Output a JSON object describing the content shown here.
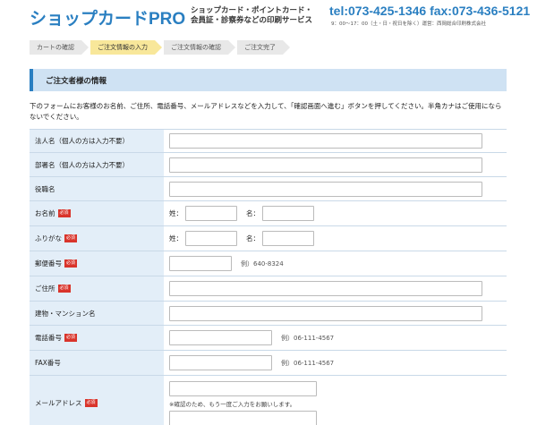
{
  "header": {
    "logo": "ショップカードPRO",
    "tagline_line1": "ショップカード・ポイントカード・",
    "tagline_line2": "会員証・診察券などの印刷サービス",
    "tel": "tel:073-425-1346 fax:073-436-5121",
    "hours": "9：00～17：00（土・日・祝日を除く）運営：西岡総合印刷株式会社"
  },
  "steps": [
    "カートの確認",
    "ご注文情報の入力",
    "ご注文情報の確認",
    "ご注文完了"
  ],
  "section": {
    "title": "ご注文者様の情報",
    "intro": "下のフォームにお客様のお名前、ご住所、電話番号、メールアドレスなどを入力して、「確認画面へ進む」ボタンを押してください。半角カナはご使用にならないでください。"
  },
  "form": {
    "required_badge": "必須",
    "company": "法人名（個人の方は入力不要）",
    "department": "部署名（個人の方は入力不要）",
    "title": "役職名",
    "name": "お名前",
    "furigana": "ふりがな",
    "sei": "姓：",
    "mei": "名：",
    "postal": "郵便番号",
    "postal_hint": "例）640-8324",
    "address": "ご住所",
    "building": "建物・マンション名",
    "phone": "電話番号",
    "phone_hint": "例）06-111-4567",
    "fax": "FAX番号",
    "fax_hint": "例）06-111-4567",
    "email": "メールアドレス",
    "email_note": "※確認のため、もう一度ご入力をお願いします。"
  }
}
